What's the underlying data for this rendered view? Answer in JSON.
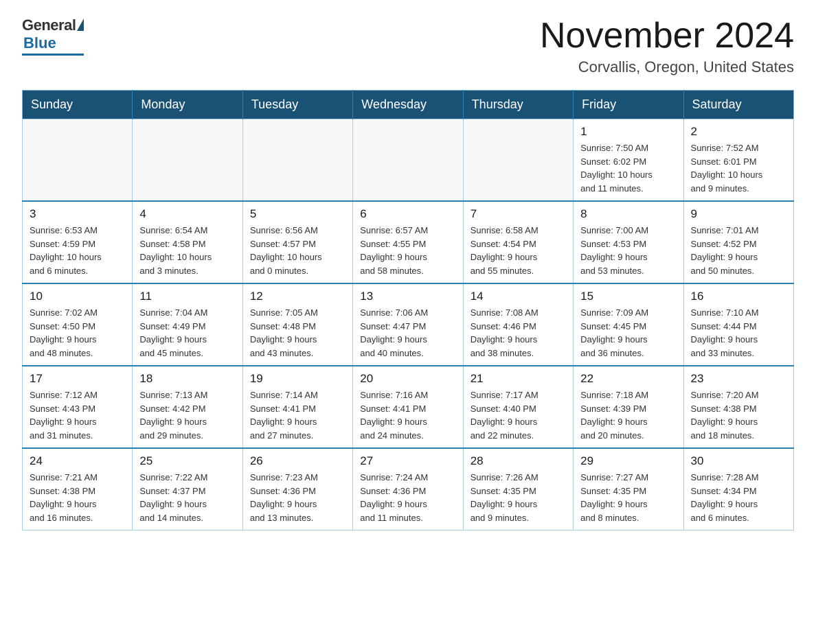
{
  "logo": {
    "general": "General",
    "blue": "Blue"
  },
  "title": "November 2024",
  "subtitle": "Corvallis, Oregon, United States",
  "days_of_week": [
    "Sunday",
    "Monday",
    "Tuesday",
    "Wednesday",
    "Thursday",
    "Friday",
    "Saturday"
  ],
  "weeks": [
    [
      {
        "day": "",
        "info": ""
      },
      {
        "day": "",
        "info": ""
      },
      {
        "day": "",
        "info": ""
      },
      {
        "day": "",
        "info": ""
      },
      {
        "day": "",
        "info": ""
      },
      {
        "day": "1",
        "info": "Sunrise: 7:50 AM\nSunset: 6:02 PM\nDaylight: 10 hours\nand 11 minutes."
      },
      {
        "day": "2",
        "info": "Sunrise: 7:52 AM\nSunset: 6:01 PM\nDaylight: 10 hours\nand 9 minutes."
      }
    ],
    [
      {
        "day": "3",
        "info": "Sunrise: 6:53 AM\nSunset: 4:59 PM\nDaylight: 10 hours\nand 6 minutes."
      },
      {
        "day": "4",
        "info": "Sunrise: 6:54 AM\nSunset: 4:58 PM\nDaylight: 10 hours\nand 3 minutes."
      },
      {
        "day": "5",
        "info": "Sunrise: 6:56 AM\nSunset: 4:57 PM\nDaylight: 10 hours\nand 0 minutes."
      },
      {
        "day": "6",
        "info": "Sunrise: 6:57 AM\nSunset: 4:55 PM\nDaylight: 9 hours\nand 58 minutes."
      },
      {
        "day": "7",
        "info": "Sunrise: 6:58 AM\nSunset: 4:54 PM\nDaylight: 9 hours\nand 55 minutes."
      },
      {
        "day": "8",
        "info": "Sunrise: 7:00 AM\nSunset: 4:53 PM\nDaylight: 9 hours\nand 53 minutes."
      },
      {
        "day": "9",
        "info": "Sunrise: 7:01 AM\nSunset: 4:52 PM\nDaylight: 9 hours\nand 50 minutes."
      }
    ],
    [
      {
        "day": "10",
        "info": "Sunrise: 7:02 AM\nSunset: 4:50 PM\nDaylight: 9 hours\nand 48 minutes."
      },
      {
        "day": "11",
        "info": "Sunrise: 7:04 AM\nSunset: 4:49 PM\nDaylight: 9 hours\nand 45 minutes."
      },
      {
        "day": "12",
        "info": "Sunrise: 7:05 AM\nSunset: 4:48 PM\nDaylight: 9 hours\nand 43 minutes."
      },
      {
        "day": "13",
        "info": "Sunrise: 7:06 AM\nSunset: 4:47 PM\nDaylight: 9 hours\nand 40 minutes."
      },
      {
        "day": "14",
        "info": "Sunrise: 7:08 AM\nSunset: 4:46 PM\nDaylight: 9 hours\nand 38 minutes."
      },
      {
        "day": "15",
        "info": "Sunrise: 7:09 AM\nSunset: 4:45 PM\nDaylight: 9 hours\nand 36 minutes."
      },
      {
        "day": "16",
        "info": "Sunrise: 7:10 AM\nSunset: 4:44 PM\nDaylight: 9 hours\nand 33 minutes."
      }
    ],
    [
      {
        "day": "17",
        "info": "Sunrise: 7:12 AM\nSunset: 4:43 PM\nDaylight: 9 hours\nand 31 minutes."
      },
      {
        "day": "18",
        "info": "Sunrise: 7:13 AM\nSunset: 4:42 PM\nDaylight: 9 hours\nand 29 minutes."
      },
      {
        "day": "19",
        "info": "Sunrise: 7:14 AM\nSunset: 4:41 PM\nDaylight: 9 hours\nand 27 minutes."
      },
      {
        "day": "20",
        "info": "Sunrise: 7:16 AM\nSunset: 4:41 PM\nDaylight: 9 hours\nand 24 minutes."
      },
      {
        "day": "21",
        "info": "Sunrise: 7:17 AM\nSunset: 4:40 PM\nDaylight: 9 hours\nand 22 minutes."
      },
      {
        "day": "22",
        "info": "Sunrise: 7:18 AM\nSunset: 4:39 PM\nDaylight: 9 hours\nand 20 minutes."
      },
      {
        "day": "23",
        "info": "Sunrise: 7:20 AM\nSunset: 4:38 PM\nDaylight: 9 hours\nand 18 minutes."
      }
    ],
    [
      {
        "day": "24",
        "info": "Sunrise: 7:21 AM\nSunset: 4:38 PM\nDaylight: 9 hours\nand 16 minutes."
      },
      {
        "day": "25",
        "info": "Sunrise: 7:22 AM\nSunset: 4:37 PM\nDaylight: 9 hours\nand 14 minutes."
      },
      {
        "day": "26",
        "info": "Sunrise: 7:23 AM\nSunset: 4:36 PM\nDaylight: 9 hours\nand 13 minutes."
      },
      {
        "day": "27",
        "info": "Sunrise: 7:24 AM\nSunset: 4:36 PM\nDaylight: 9 hours\nand 11 minutes."
      },
      {
        "day": "28",
        "info": "Sunrise: 7:26 AM\nSunset: 4:35 PM\nDaylight: 9 hours\nand 9 minutes."
      },
      {
        "day": "29",
        "info": "Sunrise: 7:27 AM\nSunset: 4:35 PM\nDaylight: 9 hours\nand 8 minutes."
      },
      {
        "day": "30",
        "info": "Sunrise: 7:28 AM\nSunset: 4:34 PM\nDaylight: 9 hours\nand 6 minutes."
      }
    ]
  ]
}
